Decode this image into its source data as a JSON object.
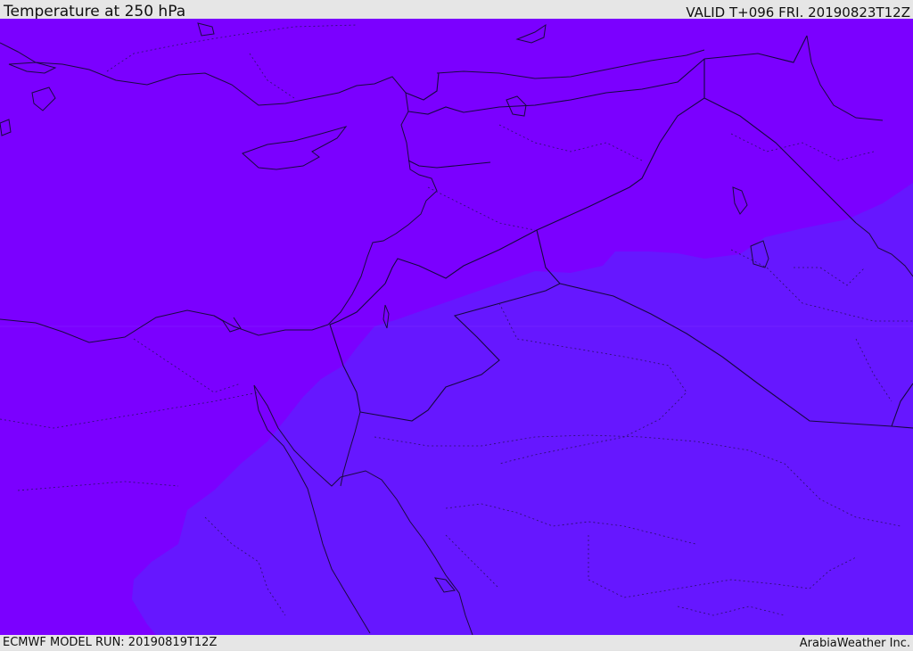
{
  "header": {
    "title": "Temperature at 250 hPa",
    "valid": "VALID T+096 FRI. 20190823T12Z"
  },
  "footer": {
    "model_run": "ECMWF MODEL RUN: 20190819T12Z",
    "credit": "ArabiaWeather Inc."
  },
  "colors": {
    "cold_band": "#7b00ff",
    "cool_band": "#6617ff",
    "coast": "#1a0a40"
  }
}
